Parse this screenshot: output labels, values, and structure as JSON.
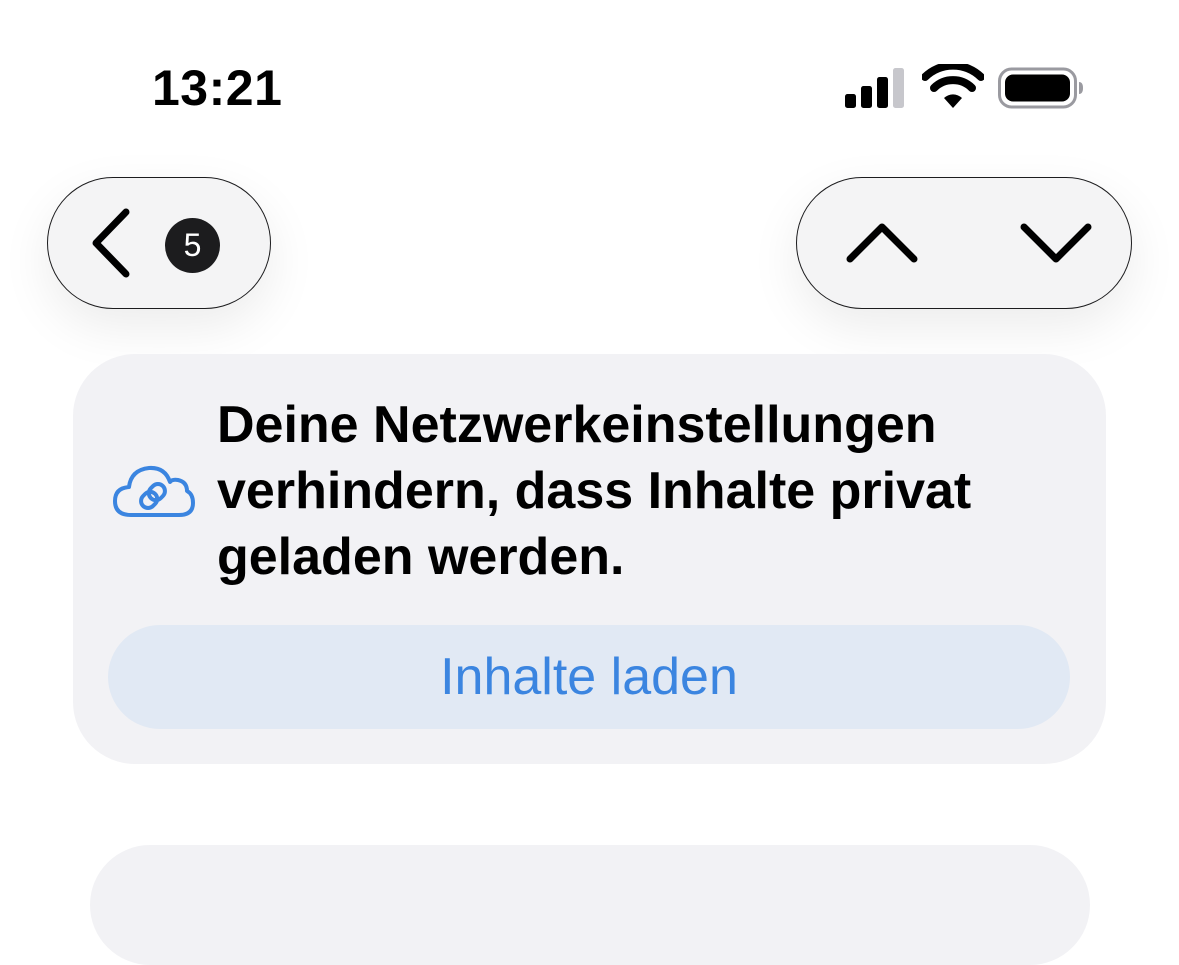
{
  "status_bar": {
    "time": "13:21",
    "icons": [
      "signal-icon",
      "wifi-icon",
      "battery-icon"
    ]
  },
  "navigation": {
    "back_icon": "chevron-left-icon",
    "count_badge": "5",
    "up_icon": "chevron-up-icon",
    "down_icon": "chevron-down-icon"
  },
  "banner": {
    "icon": "cloud-link-icon",
    "message_lines": [
      "Deine Netzwerkeinstellungen",
      "verhindern, dass Inhalte privat",
      "geladen werden."
    ],
    "button_label": "Inhalte laden"
  },
  "colors": {
    "accent": "#3b85e0",
    "button_bg": "#e1e9f4",
    "card_bg": "#f2f2f5",
    "pill_bg": "#f4f4f5",
    "text": "#000000"
  }
}
